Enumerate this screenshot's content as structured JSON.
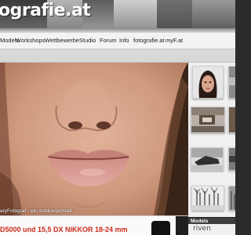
{
  "header": {
    "logo_text": "ografie.at"
  },
  "nav": {
    "items": [
      {
        "label": "Models"
      },
      {
        "label": "Workshops"
      },
      {
        "label": "Wettbewerbe"
      },
      {
        "label": "Studio"
      },
      {
        "label": "Forum"
      },
      {
        "label": "Info"
      },
      {
        "label": "fotografie.at"
      },
      {
        "label": "myF.at"
      }
    ]
  },
  "hero": {
    "caption": "aryFotograf - ein outdoorportrait"
  },
  "bottom": {
    "text": "D5000 und 15,5 DX NIKKOR 18-24 mm"
  },
  "sidebar": {
    "models_title": "Models",
    "models_name": "riven"
  },
  "colors": {
    "accent_red": "#cc2a1c",
    "nav_bg": "#f3f3f3",
    "header_dark": "#3e3e3e"
  }
}
